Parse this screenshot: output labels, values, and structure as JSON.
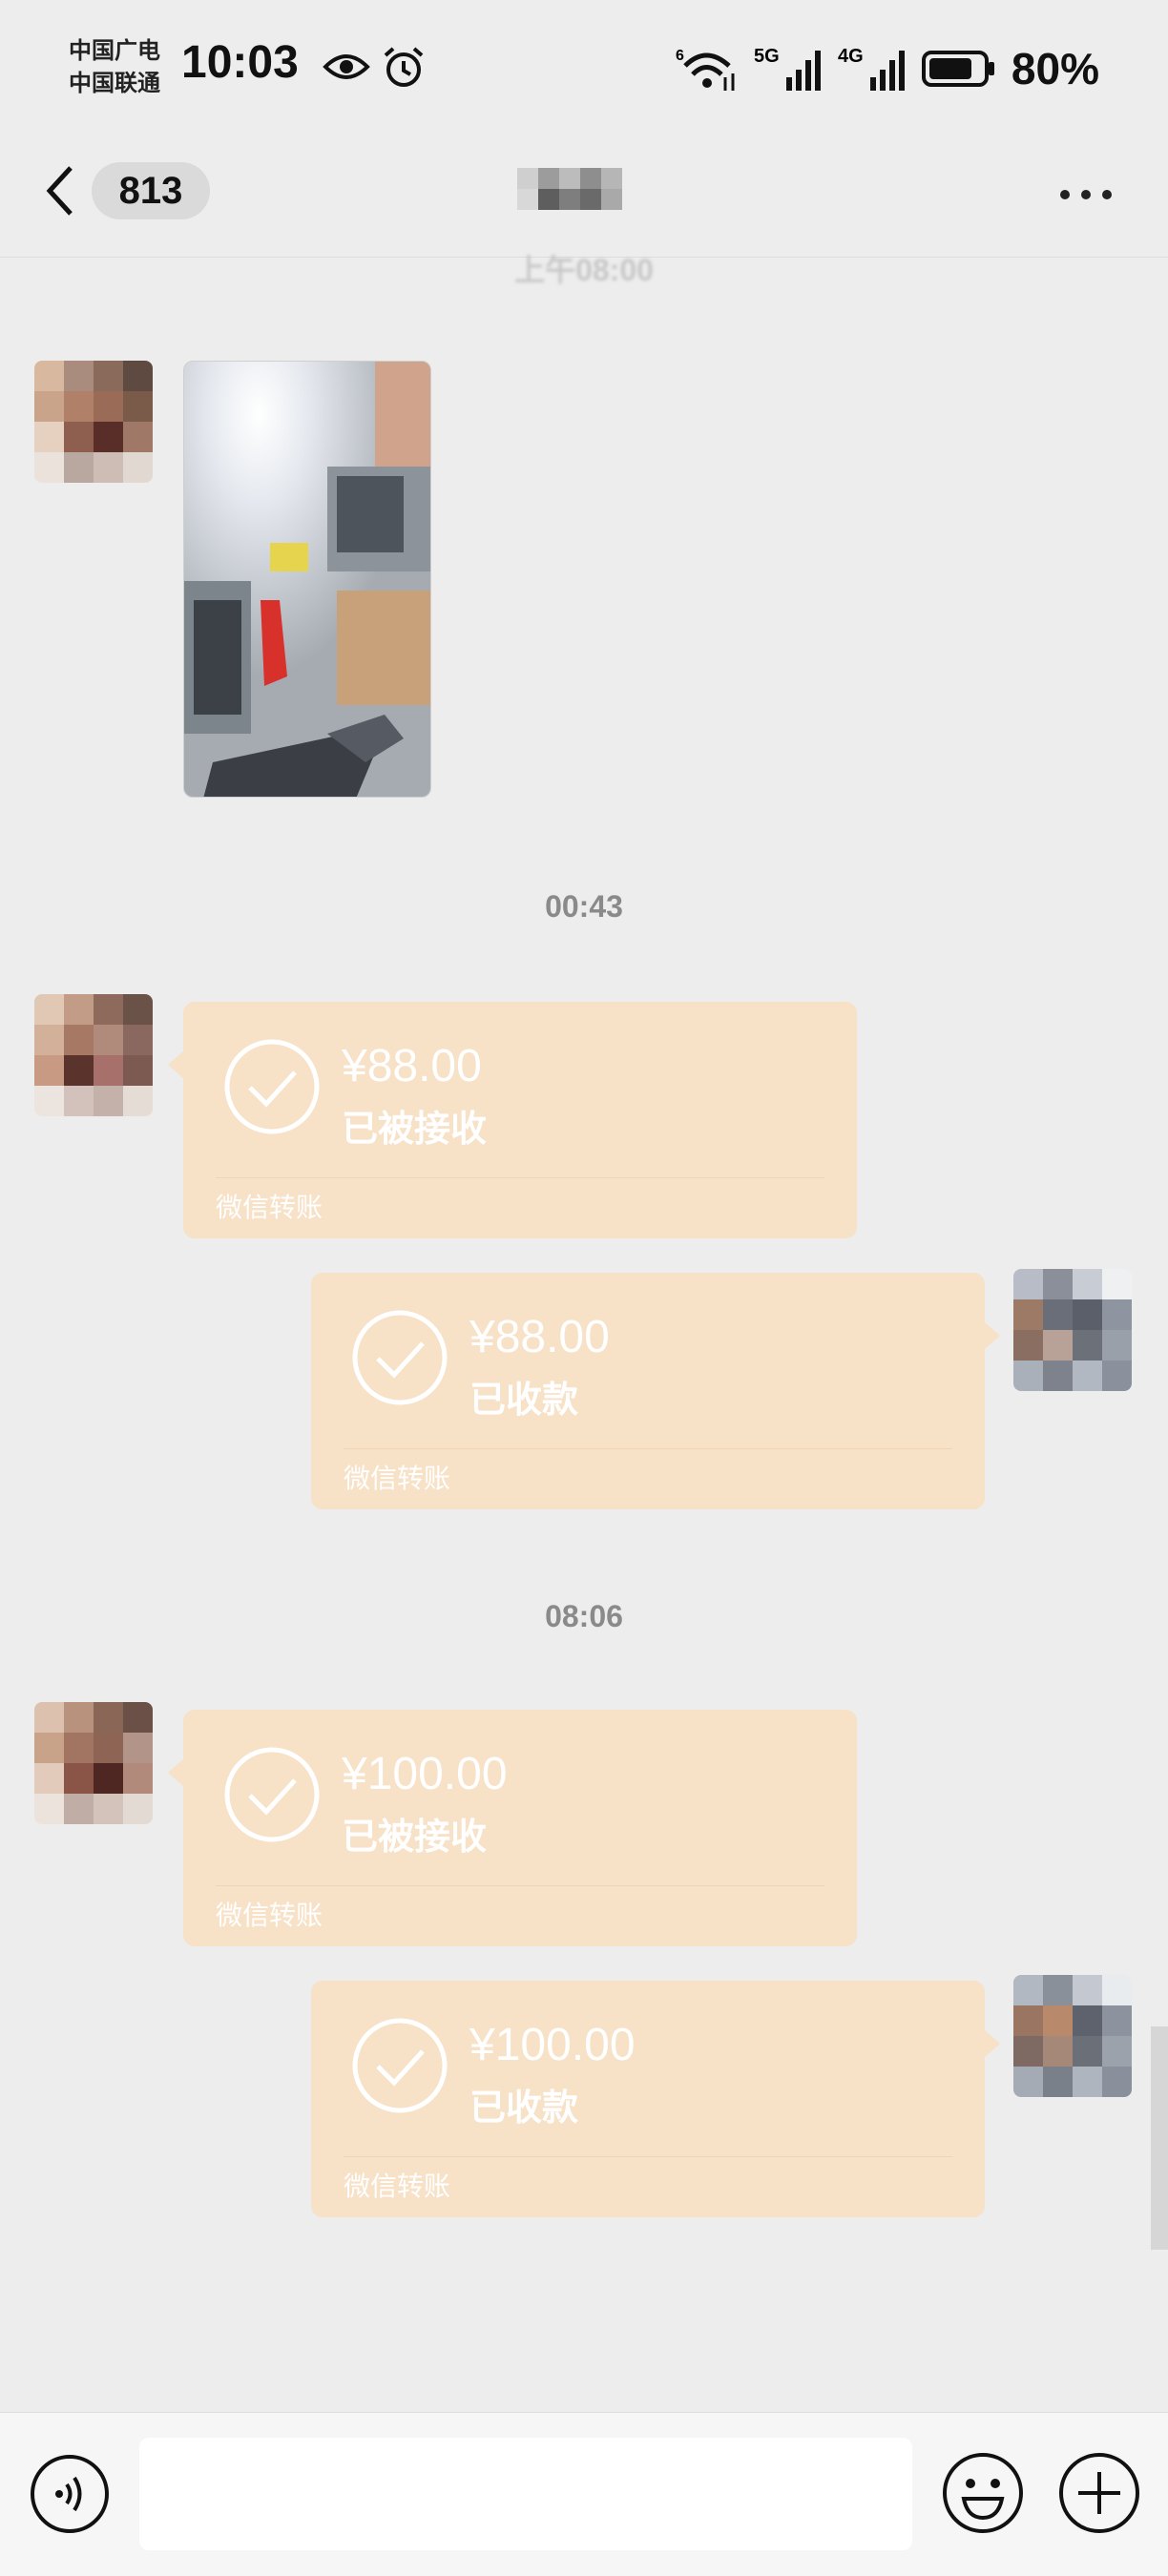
{
  "status_bar": {
    "carrier_line1": "中国广电",
    "carrier_line2": "中国联通",
    "time": "10:03",
    "signal_label_1": "6",
    "signal_label_2": "5G",
    "signal_label_3": "4G",
    "battery": "80%",
    "icons": [
      "eye-icon",
      "alarm-icon",
      "wifi-icon",
      "signal-5g-icon",
      "signal-4g-icon",
      "battery-icon"
    ]
  },
  "nav": {
    "unread_count": "813",
    "icons": [
      "back-icon",
      "more-icon"
    ]
  },
  "messages": {
    "top_faded_timestamp": "上午08:00",
    "timestamp_1": "00:43",
    "timestamp_2": "08:06",
    "transfer_1": {
      "amount": "¥88.00",
      "status": "已被接收",
      "label": "微信转账"
    },
    "transfer_2": {
      "amount": "¥88.00",
      "status": "已收款",
      "label": "微信转账"
    },
    "transfer_3": {
      "amount": "¥100.00",
      "status": "已被接收",
      "label": "微信转账"
    },
    "transfer_4": {
      "amount": "¥100.00",
      "status": "已收款",
      "label": "微信转账"
    }
  },
  "input_bar": {
    "placeholder": "",
    "icons": [
      "voice-icon",
      "emoji-icon",
      "plus-icon"
    ]
  },
  "colors": {
    "background": "#ededed",
    "transfer_bubble": "#f7e1c7",
    "timestamp_text": "#8a8a8a"
  }
}
